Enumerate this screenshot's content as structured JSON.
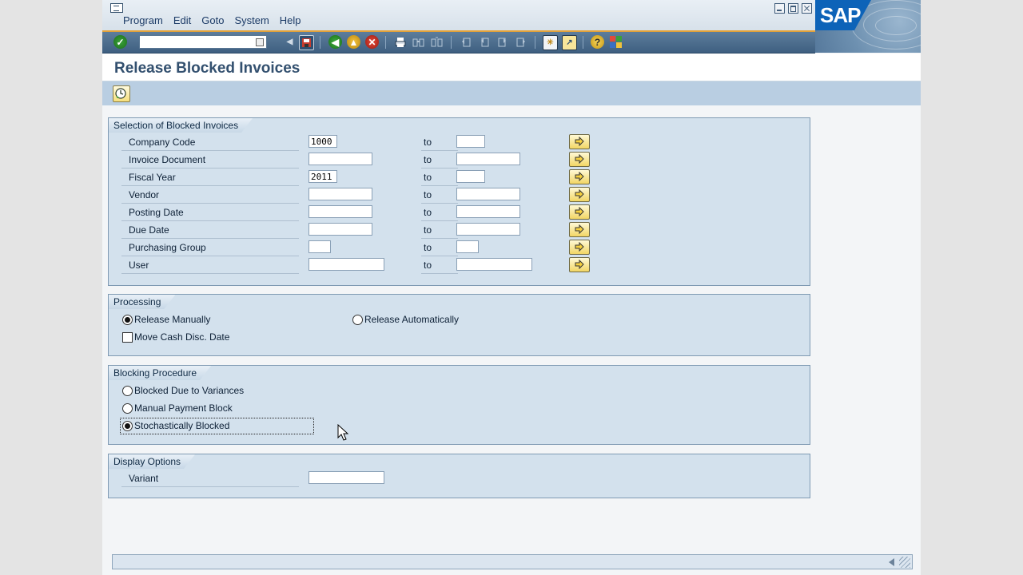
{
  "menu": {
    "items": [
      "Program",
      "Edit",
      "Goto",
      "System",
      "Help"
    ]
  },
  "logo": "SAP",
  "toolbar": {
    "command_field_value": "",
    "icons": [
      "check-icon",
      "save-icon",
      "back-icon",
      "exit-icon",
      "cancel-icon",
      "print-icon",
      "find-icon",
      "find-next-icon",
      "first-page-icon",
      "previous-page-icon",
      "next-page-icon",
      "last-page-icon",
      "create-session-icon",
      "shortcut-icon",
      "help-icon",
      "layout-menu-icon"
    ]
  },
  "page": {
    "title": "Release Blocked Invoices"
  },
  "selection": {
    "title": "Selection of Blocked Invoices",
    "to_label": "to",
    "rows": [
      {
        "label": "Company Code",
        "from": "1000",
        "to": ""
      },
      {
        "label": "Invoice Document",
        "from": "",
        "to": ""
      },
      {
        "label": "Fiscal Year",
        "from": "2011",
        "to": ""
      },
      {
        "label": "Vendor",
        "from": "",
        "to": ""
      },
      {
        "label": "Posting Date",
        "from": "",
        "to": ""
      },
      {
        "label": "Due Date",
        "from": "",
        "to": ""
      },
      {
        "label": "Purchasing Group",
        "from": "",
        "to": ""
      },
      {
        "label": "User",
        "from": "",
        "to": ""
      }
    ]
  },
  "processing": {
    "title": "Processing",
    "release_manually": "Release Manually",
    "release_automatically": "Release Automatically",
    "move_cash_disc_date": "Move Cash Disc. Date",
    "selected": "release_manually",
    "move_checked": false
  },
  "blocking": {
    "title": "Blocking Procedure",
    "options": [
      "Blocked Due to Variances",
      "Manual Payment Block",
      "Stochastically Blocked"
    ],
    "selected_index": 2
  },
  "display": {
    "title": "Display Options",
    "variant_label": "Variant",
    "variant_value": ""
  },
  "colors": {
    "accent": "#e2a23a",
    "toolbar": "#4a6b8c",
    "panel": "#d3e1ed",
    "title": "#33506f"
  }
}
